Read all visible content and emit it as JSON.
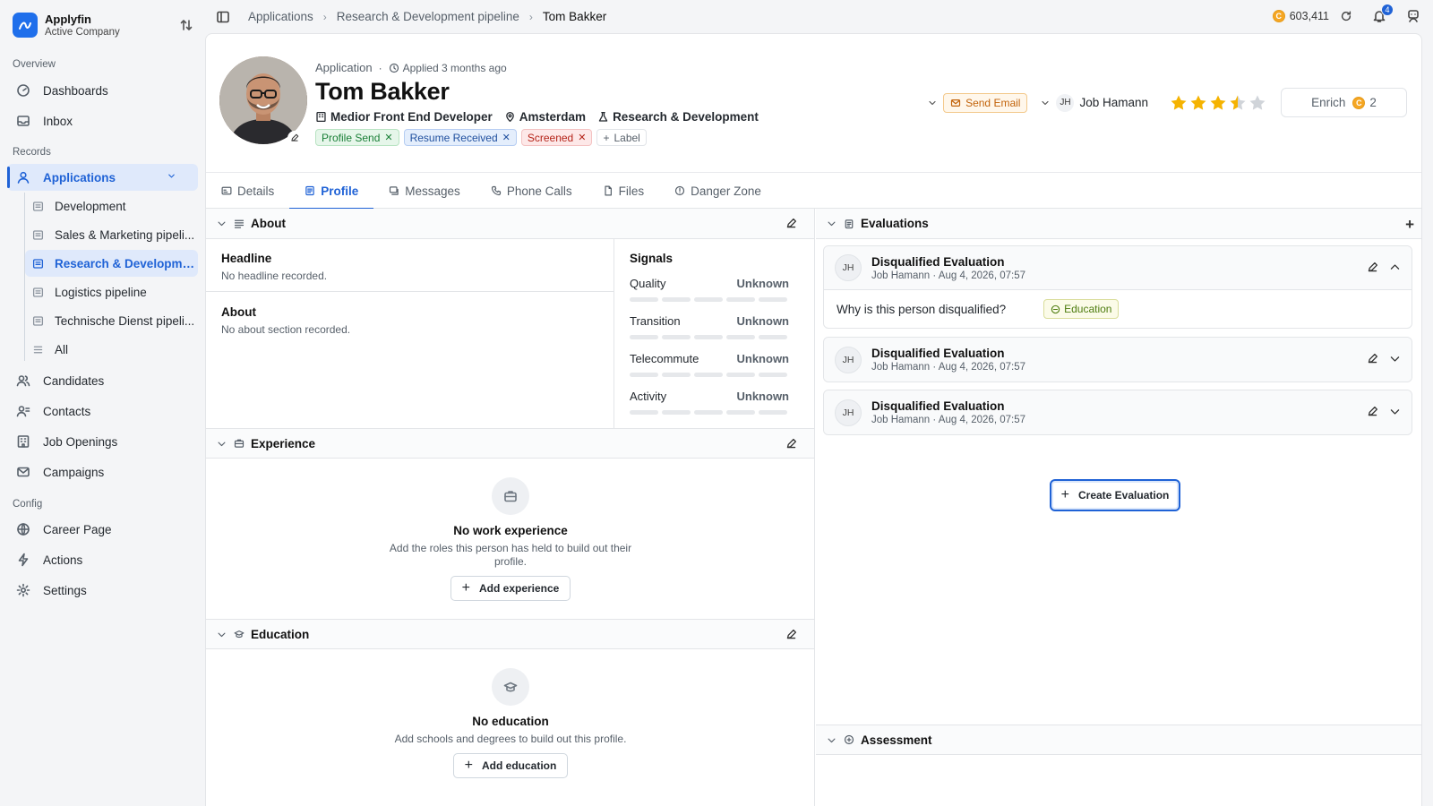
{
  "brand": {
    "name": "Applyfin",
    "company": "Active Company"
  },
  "sidebar": {
    "overview_title": "Overview",
    "records_title": "Records",
    "config_title": "Config",
    "dashboards": "Dashboards",
    "inbox": "Inbox",
    "applications": "Applications",
    "sub_items": [
      "Development",
      "Sales & Marketing pipeli...",
      "Research & Developme...",
      "Logistics pipeline",
      "Technische Dienst pipeli...",
      "All"
    ],
    "candidates": "Candidates",
    "contacts": "Contacts",
    "job_openings": "Job Openings",
    "campaigns": "Campaigns",
    "career_page": "Career Page",
    "actions": "Actions",
    "settings": "Settings"
  },
  "topbar": {
    "breadcrumbs": [
      "Applications",
      "Research & Development pipeline",
      "Tom Bakker"
    ],
    "credits": "603,411",
    "coin_symbol": "C",
    "notifications": "4"
  },
  "header": {
    "kind": "Application",
    "applied": "Applied 3 months ago",
    "name": "Tom Bakker",
    "role": "Medior Front End Developer",
    "location": "Amsterdam",
    "department": "Research & Development",
    "labels": [
      "Profile Send",
      "Resume Received",
      "Screened"
    ],
    "add_label": "Label",
    "send_email": "Send Email",
    "owner_initials": "JH",
    "owner_name": "Job Hamann",
    "rating": 3.5,
    "enrich_label": "Enrich",
    "enrich_cost": "2"
  },
  "tabs": [
    "Details",
    "Profile",
    "Messages",
    "Phone Calls",
    "Files",
    "Danger Zone"
  ],
  "about": {
    "title": "About",
    "headline_label": "Headline",
    "headline_value": "No headline recorded.",
    "about_label": "About",
    "about_value": "No about section recorded.",
    "signals_title": "Signals",
    "signals": [
      {
        "name": "Quality",
        "value": "Unknown"
      },
      {
        "name": "Transition",
        "value": "Unknown"
      },
      {
        "name": "Telecommute",
        "value": "Unknown"
      },
      {
        "name": "Activity",
        "value": "Unknown"
      }
    ]
  },
  "experience": {
    "title": "Experience",
    "empty_title": "No work experience",
    "empty_desc": "Add the roles this person has held to build out their profile.",
    "button": "Add experience"
  },
  "education": {
    "title": "Education",
    "empty_title": "No education",
    "empty_desc": "Add schools and degrees to build out this profile.",
    "button": "Add education"
  },
  "evaluations": {
    "title": "Evaluations",
    "items": [
      {
        "initials": "JH",
        "title": "Disqualified Evaluation",
        "meta": "Job Hamann · Aug 4, 2026, 07:57",
        "question": "Why is this person disqualified?",
        "answer": "Education"
      },
      {
        "initials": "JH",
        "title": "Disqualified Evaluation",
        "meta": "Job Hamann · Aug 4, 2026, 07:57"
      },
      {
        "initials": "JH",
        "title": "Disqualified Evaluation",
        "meta": "Job Hamann · Aug 4, 2026, 07:57"
      }
    ],
    "create_button": "Create Evaluation"
  },
  "assessment": {
    "title": "Assessment"
  },
  "colors": {
    "accent": "#1f62d6",
    "brand": "#1f6feb",
    "star": "#f5b301"
  }
}
